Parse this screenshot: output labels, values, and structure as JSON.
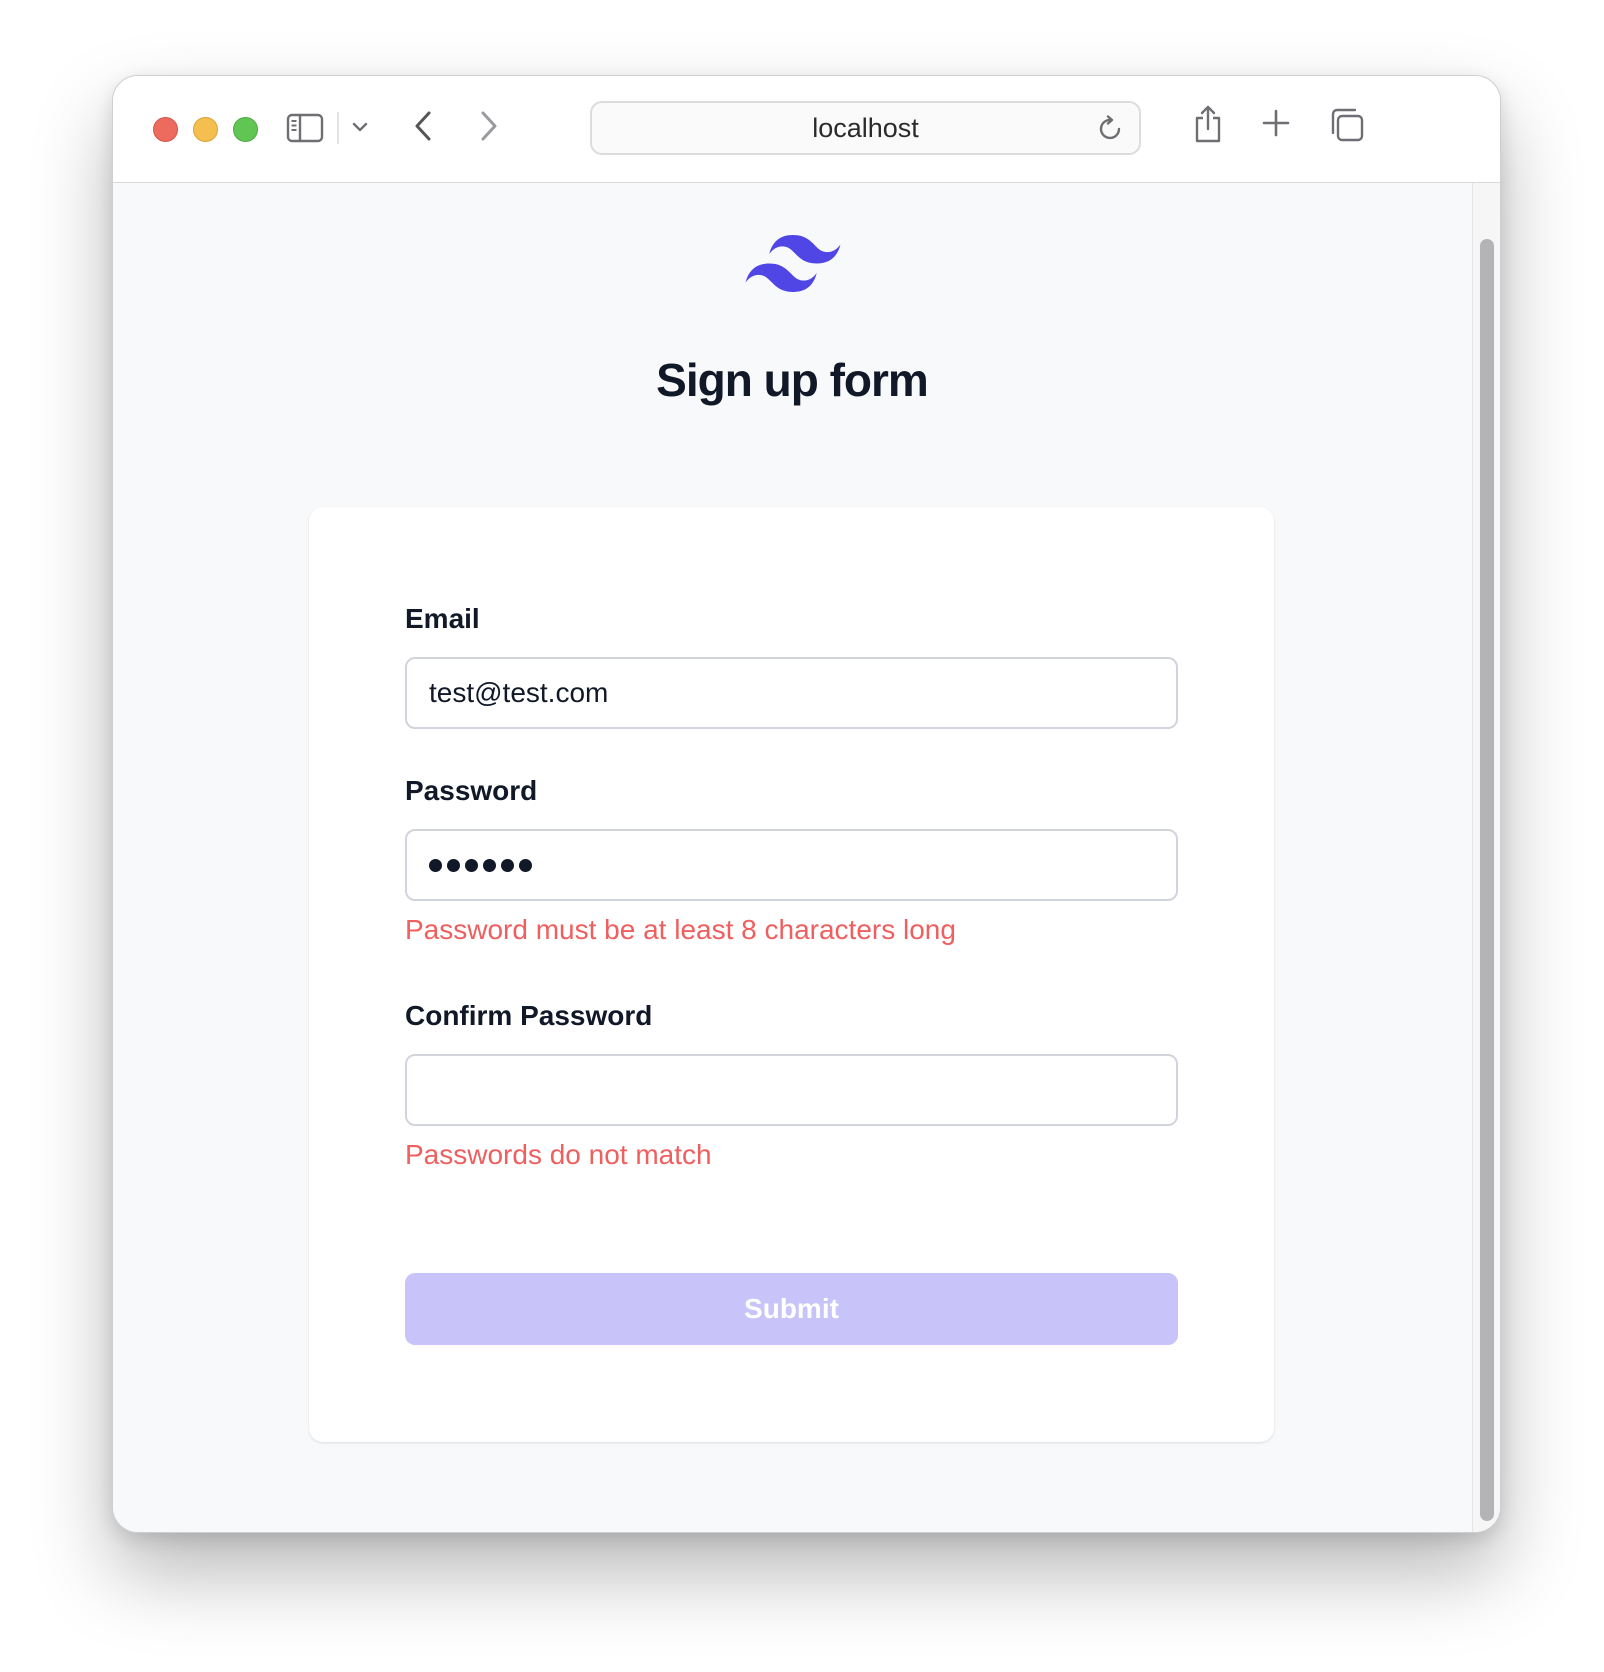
{
  "browser": {
    "url": "localhost",
    "icons": {
      "sidebar": "sidebar-toggle-icon",
      "chevron": "chevron-down-icon",
      "back": "back-arrow-icon",
      "forward": "forward-arrow-icon",
      "reload": "reload-icon",
      "share": "share-icon",
      "new_tab": "plus-icon",
      "tabs": "tab-overview-icon"
    }
  },
  "page": {
    "title": "Sign up form",
    "logo_color": "#4f46e5"
  },
  "form": {
    "email_label": "Email",
    "email_value": "test@test.com",
    "password_label": "Password",
    "password_masked_length": 6,
    "password_error": "Password must be at least 8 characters long",
    "confirm_label": "Confirm Password",
    "confirm_value": "",
    "confirm_error": "Passwords do not match",
    "submit_label": "Submit"
  },
  "colors": {
    "error": "#ef5f5f",
    "submit_disabled": "#c8c3f8",
    "brand": "#4f46e5",
    "heading": "#111827"
  }
}
